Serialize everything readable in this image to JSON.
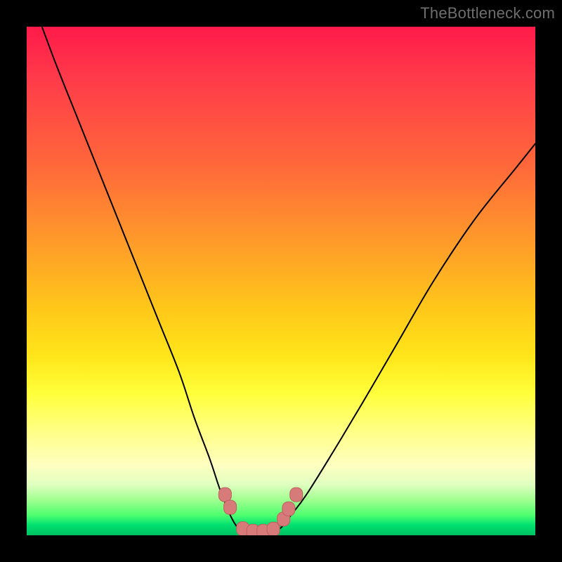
{
  "watermark": "TheBottleneck.com",
  "chart_data": {
    "type": "line",
    "title": "",
    "xlabel": "",
    "ylabel": "",
    "xlim": [
      0,
      100
    ],
    "ylim": [
      0,
      100
    ],
    "series": [
      {
        "name": "left-curve",
        "x": [
          3,
          6,
          10,
          14,
          18,
          22,
          26,
          30,
          33,
          36,
          38,
          40,
          41.5,
          43
        ],
        "y": [
          100,
          92,
          82,
          72,
          62,
          52,
          42,
          32,
          23,
          15,
          9,
          4,
          1.5,
          0.5
        ]
      },
      {
        "name": "right-curve",
        "x": [
          48,
          50,
          52,
          55,
          60,
          66,
          73,
          80,
          88,
          96,
          100
        ],
        "y": [
          0.5,
          1.5,
          4,
          8,
          16,
          26,
          38,
          50,
          62,
          72,
          77
        ]
      },
      {
        "name": "floor",
        "x": [
          43,
          44,
          45,
          46,
          47,
          48
        ],
        "y": [
          0.5,
          0.3,
          0.3,
          0.3,
          0.3,
          0.5
        ]
      }
    ],
    "markers": [
      {
        "name": "left-marker-upper",
        "x": 39.0,
        "y": 8.0
      },
      {
        "name": "left-marker-lower",
        "x": 40.0,
        "y": 5.5
      },
      {
        "name": "floor-marker-1",
        "x": 42.5,
        "y": 1.3
      },
      {
        "name": "floor-marker-2",
        "x": 44.5,
        "y": 0.8
      },
      {
        "name": "floor-marker-3",
        "x": 46.5,
        "y": 0.8
      },
      {
        "name": "floor-marker-4",
        "x": 48.5,
        "y": 1.2
      },
      {
        "name": "right-marker-lower",
        "x": 50.5,
        "y": 3.2
      },
      {
        "name": "right-marker-mid",
        "x": 51.5,
        "y": 5.2
      },
      {
        "name": "right-marker-upper",
        "x": 53.0,
        "y": 8.0
      }
    ],
    "colors": {
      "curve": "#000000",
      "marker_fill": "#d77a7a",
      "marker_stroke": "#c06060"
    }
  }
}
